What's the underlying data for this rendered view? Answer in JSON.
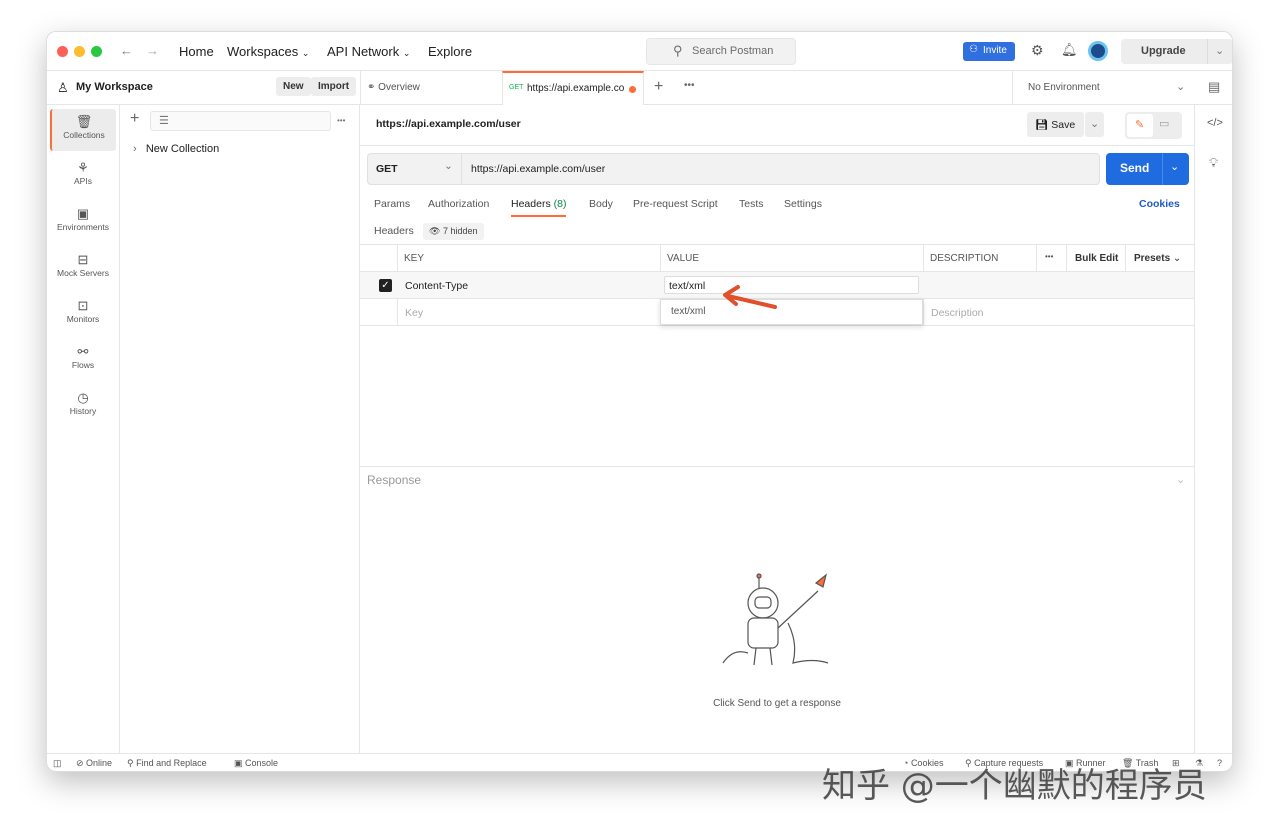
{
  "titlebar": {
    "nav": [
      "Home",
      "Workspaces",
      "API Network",
      "Explore"
    ],
    "search_placeholder": "Search Postman",
    "invite": "Invite",
    "upgrade": "Upgrade"
  },
  "workspace": {
    "name": "My Workspace",
    "new": "New",
    "import": "Import"
  },
  "tabs": [
    {
      "label": "Overview"
    },
    {
      "method": "GET",
      "label": "https://api.example.cor"
    }
  ],
  "environment": "No Environment",
  "sidebar": {
    "items": [
      {
        "label": "Collections",
        "icon": "trash-can-icon"
      },
      {
        "label": "APIs",
        "icon": "apis-icon"
      },
      {
        "label": "Environments",
        "icon": "environment-icon"
      },
      {
        "label": "Mock Servers",
        "icon": "server-icon"
      },
      {
        "label": "Monitors",
        "icon": "monitor-icon"
      },
      {
        "label": "Flows",
        "icon": "flows-icon"
      },
      {
        "label": "History",
        "icon": "history-icon"
      }
    ]
  },
  "collections": [
    {
      "label": "New Collection"
    }
  ],
  "request": {
    "title": "https://api.example.com/user",
    "save": "Save",
    "method": "GET",
    "url": "https://api.example.com/user",
    "send": "Send",
    "tabs": [
      "Params",
      "Authorization",
      "Headers",
      "Body",
      "Pre-request Script",
      "Tests",
      "Settings"
    ],
    "headers_count": "(8)",
    "cookies": "Cookies",
    "headers_label": "Headers",
    "hidden": "7 hidden",
    "columns": [
      "KEY",
      "VALUE",
      "DESCRIPTION"
    ],
    "bulk_edit": "Bulk Edit",
    "presets": "Presets",
    "rows": [
      {
        "checked": true,
        "key": "Content-Type",
        "value": "text/xml"
      }
    ],
    "placeholders": {
      "key": "Key",
      "description": "Description"
    },
    "autocomplete": [
      "text/xml"
    ]
  },
  "response": {
    "label": "Response",
    "hint": "Click Send to get a response"
  },
  "status": {
    "left": [
      "Online",
      "Find and Replace",
      "Console"
    ],
    "right": [
      "Cookies",
      "Capture requests",
      "Runner",
      "Trash"
    ]
  },
  "colors": {
    "accent": "#ff6c37",
    "primary": "#2f6fe0"
  },
  "watermark": "知乎 @一个幽默的程序员"
}
